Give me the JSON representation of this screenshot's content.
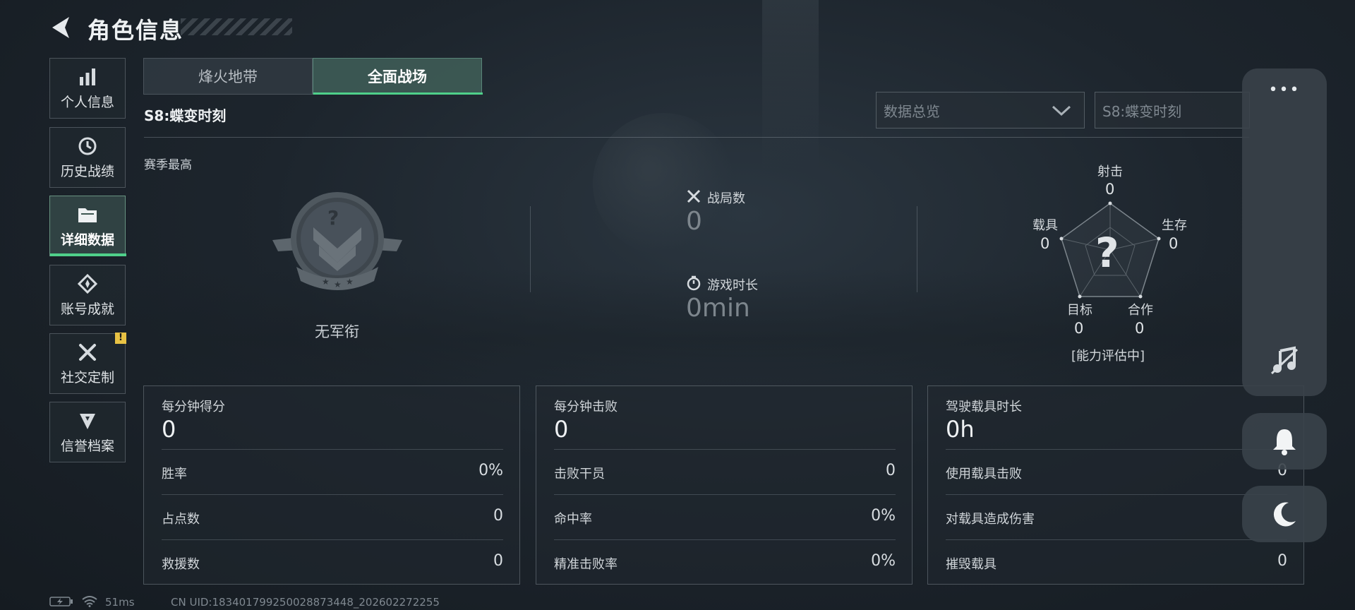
{
  "header": {
    "title": "角色信息"
  },
  "sidebar": {
    "items": [
      {
        "label": "个人信息",
        "icon": "bar-chart-icon"
      },
      {
        "label": "历史战绩",
        "icon": "history-icon"
      },
      {
        "label": "详细数据",
        "icon": "folder-icon",
        "active": true
      },
      {
        "label": "账号成就",
        "icon": "achievement-icon"
      },
      {
        "label": "社交定制",
        "icon": "tools-icon",
        "badge": "!"
      },
      {
        "label": "信誉档案",
        "icon": "shield-badge-icon"
      }
    ]
  },
  "tabs": [
    {
      "label": "烽火地带",
      "active": false
    },
    {
      "label": "全面战场",
      "active": true
    }
  ],
  "season": {
    "name": "S8:蝶变时刻"
  },
  "filters": {
    "category": {
      "value": "数据总览"
    },
    "season": {
      "value": "S8:蝶变时刻"
    }
  },
  "season_best": {
    "label": "赛季最高",
    "rank": "无军衔",
    "rank_badge_glyph": "?",
    "matches": {
      "label": "战局数",
      "value": "0"
    },
    "playtime": {
      "label": "游戏时长",
      "value": "0min"
    }
  },
  "radar": {
    "center_glyph": "?",
    "status": "[能力评估中]",
    "axes": [
      {
        "label": "射击",
        "value": "0"
      },
      {
        "label": "生存",
        "value": "0"
      },
      {
        "label": "合作",
        "value": "0"
      },
      {
        "label": "目标",
        "value": "0"
      },
      {
        "label": "载具",
        "value": "0"
      }
    ]
  },
  "panels": [
    {
      "title": "每分钟得分",
      "value": "0",
      "rows": [
        {
          "label": "胜率",
          "value": "0%"
        },
        {
          "label": "占点数",
          "value": "0"
        },
        {
          "label": "救援数",
          "value": "0"
        }
      ]
    },
    {
      "title": "每分钟击败",
      "value": "0",
      "rows": [
        {
          "label": "击败干员",
          "value": "0"
        },
        {
          "label": "命中率",
          "value": "0%"
        },
        {
          "label": "精准击败率",
          "value": "0%"
        }
      ]
    },
    {
      "title": "驾驶载具时长",
      "value": "0h",
      "rows": [
        {
          "label": "使用载具击败",
          "value": "0"
        },
        {
          "label": "对载具造成伤害",
          "value": ""
        },
        {
          "label": "摧毁载具",
          "value": "0"
        }
      ]
    }
  ],
  "floating": {
    "menu_glyph": "•••"
  },
  "footer": {
    "ping": "51ms",
    "uid": "CN UID:18340179925002887​3448_202602272255"
  },
  "colors": {
    "accent": "#4fd08a",
    "warning": "#e8c244"
  }
}
